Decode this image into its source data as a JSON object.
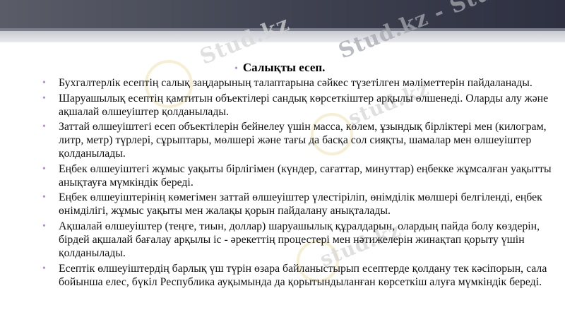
{
  "watermark": {
    "text_1": "Stud.kz",
    "text_2": "Stud.kz - Stud.kz",
    "text_3": "stud.kz",
    "text_4": "stud.kz"
  },
  "slide": {
    "title": "Салықты есеп.",
    "bullets": [
      "Бухгалтерлік есептің салық заңдарының талаптарына сәйкес түзетілген мәліметтерін пайдаланады.",
      "Шаруашылық есептің қамтитын объектілері сандық көрсеткіштер арқылы өлшенеді. Оларды алу және ақшалай өлшеуіштер қолданылады.",
      "Заттай өлшеуіштегі есеп объектілерін бейнелеу үшін масса, көлем, ұзындық бірліктері мен (килограм, литр, метр) түрлері, сұрыптары, мөлшері және тағы да басқа сол сияқты, шамалар мен өлшеуіштер қолданылады.",
      " Еңбек өлшеуіштегі жұмыс уақыты бірлігімен (күндер, сағаттар, минуттар) еңбекке жұмсалған уақытты анықтауға мүмкіндік береді.",
      "Еңбек өлшеуіштерінің көмегімен заттай өлшеуіштер үлестіріліп, өнімділік мөлшері белгіленді, еңбек өнімділігі, жұмыс уақыты мен жалақы қорын пайдалану анықталады.",
      "Ақшалай өлшеуіштер (теңге, тиын, доллар) шаруашылық құралдарын, олардың пайда болу көздерін, бірдей ақшалай бағалау арқылы іс - әрекеттің процестері мен нәтижелерін жинақтап қорыту үшін қолданылады.",
      "Есептік өлшеуіштердің барлық үш түрін өзара  байланыстырып есептерде қолдану тек кәсіпорын, сала бойынша елес, бүкіл Республика ауқымында да қорытындыланған көрсеткіш алуға мүмкіндік береді."
    ]
  }
}
